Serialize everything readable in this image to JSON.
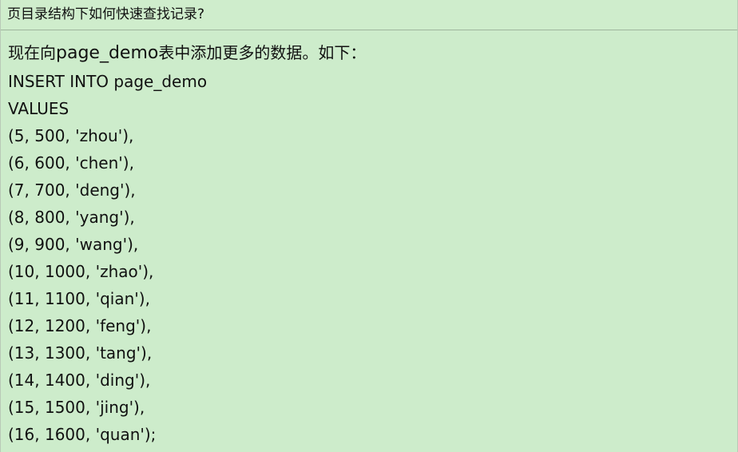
{
  "header": {
    "title": "页目录结构下如何快速查找记录?"
  },
  "content": {
    "intro_prefix": "现在向",
    "intro_code": "page_demo",
    "intro_suffix": "表中添加更多的数据。如下：",
    "lines": [
      "INSERT INTO page_demo",
      "VALUES",
      "(5, 500, 'zhou'),",
      "(6, 600, 'chen'),",
      "(7, 700, 'deng'),",
      "(8, 800, 'yang'),",
      "(9, 900, 'wang'),",
      "(10, 1000, 'zhao'),",
      "(11, 1100, 'qian'),",
      "(12, 1200, 'feng'),",
      "(13, 1300, 'tang'),",
      "(14, 1400, 'ding'),",
      "(15, 1500, 'jing'),",
      "(16, 1600, 'quan');"
    ]
  }
}
